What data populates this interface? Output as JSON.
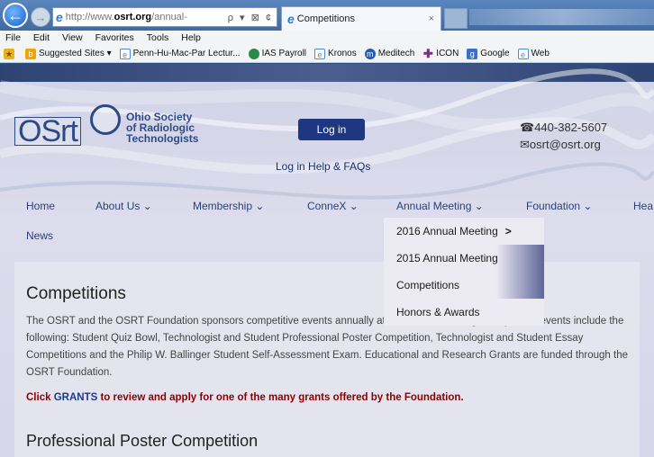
{
  "browser": {
    "back_icon": "back-arrow-icon",
    "forward_icon": "forward-arrow-icon",
    "url_prefix": "http://www.",
    "url_domain": "osrt.org",
    "url_suffix": "/annual-",
    "address_tools": "ρ ▾ ⊠ ¢",
    "tab_title": "Competitions",
    "tab_close": "×",
    "menu": [
      "File",
      "Edit",
      "View",
      "Favorites",
      "Tools",
      "Help"
    ],
    "favorites": [
      {
        "label": "",
        "icon": "star"
      },
      {
        "label": "Suggested Sites ▾",
        "icon": "bing"
      },
      {
        "label": "Penn-Hu-Mac-Par Lectur...",
        "icon": "page"
      },
      {
        "label": "IAS Payroll",
        "icon": "globe"
      },
      {
        "label": "Kronos",
        "icon": "page"
      },
      {
        "label": "Meditech",
        "icon": "meditech"
      },
      {
        "label": "ICON",
        "icon": "cross"
      },
      {
        "label": "Google",
        "icon": "google"
      },
      {
        "label": "Web",
        "icon": "page"
      }
    ]
  },
  "header": {
    "logo_text": "OSrt",
    "org_name_1": "Ohio Society",
    "org_name_2": "of Radiologic",
    "org_name_3": "Technologists",
    "login_label": "Log in",
    "login_help": "Log in Help & FAQs",
    "phone": "☎440-382-5607",
    "email": "✉osrt@osrt.org"
  },
  "nav": {
    "items": [
      "Home",
      "About Us ⌄",
      "Membership ⌄",
      "ConneX ⌄",
      "Annual Meeting ⌄",
      "Foundation ⌄",
      "Hea"
    ],
    "news": "News"
  },
  "dropdown": {
    "items": [
      "2016 Annual Meeting",
      "2015 Annual Meeting",
      "Competitions",
      "Honors & Awards"
    ],
    "chevron": ">"
  },
  "content": {
    "title": "Competitions",
    "para": "The OSRT and the OSRT Foundation sponsors competitive events annually at the Annual Meeting. Competitive events include the following: Student Quiz Bowl, Technologist and Student Professional Poster Competition, Technologist and Student Essay Competitions and the Philip W. Ballinger Student Self-Assessment Exam. Educational and Research Grants are funded through the OSRT Foundation.",
    "grant_pre": "Click ",
    "grant_link": "GRANTS",
    "grant_post": " to review and apply for one of the many grants offered by the Foundation.",
    "subtitle": "Professional Poster Competition"
  }
}
